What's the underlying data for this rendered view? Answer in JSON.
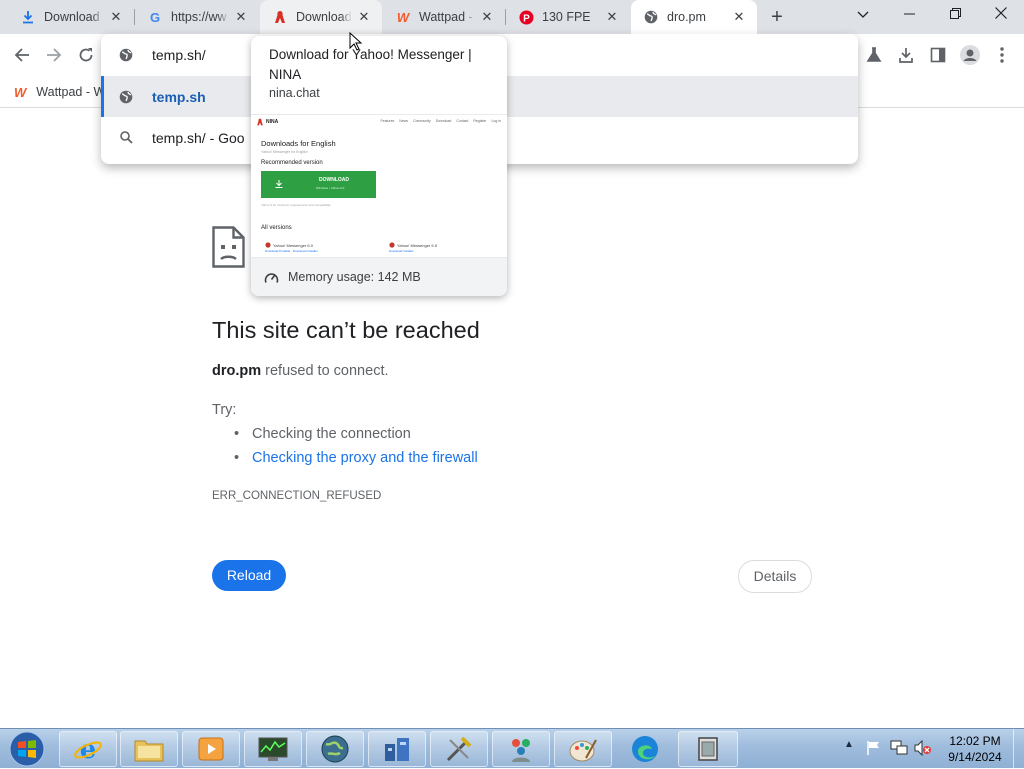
{
  "tabs": [
    {
      "title": "Download",
      "icon": "download-icon"
    },
    {
      "title": "https://ww",
      "icon": "google-icon"
    },
    {
      "title": "Download",
      "icon": "nina-icon"
    },
    {
      "title": "Wattpad -",
      "icon": "wattpad-icon"
    },
    {
      "title": "130 FPE",
      "icon": "pinterest-icon"
    },
    {
      "title": "dro.pm",
      "icon": "globe-icon"
    }
  ],
  "omnibox": {
    "input_value": "temp.sh/",
    "suggestions": [
      {
        "text": "temp.sh",
        "icon": "globe-icon"
      },
      {
        "text": "temp.sh/ - Goo",
        "icon": "search-icon"
      }
    ]
  },
  "bookmarks": [
    {
      "label": "Wattpad - W",
      "icon": "wattpad-icon"
    }
  ],
  "hover_card": {
    "title": "Download for Yahoo! Messenger | NINA",
    "domain": "nina.chat",
    "memory": "Memory usage: 142 MB",
    "thumbnail": {
      "brand": "NINA",
      "nav": [
        "Features",
        "News",
        "Community",
        "Download",
        "Contact",
        "Register",
        "Log in"
      ],
      "heading": "Downloads for English",
      "subheading": "Yahoo! Messenger for English",
      "recommended": "Recommended version",
      "download_label": "DOWNLOAD",
      "download_sub": "Windows • Yahoo 6.0",
      "note": "Yahoo 9 for minimum requirements and compatibility",
      "all_versions": "All versions",
      "versions": [
        "Yahoo! Messenger 6.0",
        "Yahoo! Messenger 5.5"
      ],
      "version_subs": [
        "Download Portable · Download Installer",
        "Download Installer"
      ]
    }
  },
  "error": {
    "heading": "This site can’t be reached",
    "domain": "dro.pm",
    "message": " refused to connect.",
    "try_label": "Try:",
    "suggestions": [
      "Checking the connection",
      "Checking the proxy and the firewall"
    ],
    "code": "ERR_CONNECTION_REFUSED",
    "reload_label": "Reload",
    "details_label": "Details"
  },
  "taskbar": {
    "apps": [
      "ie-icon",
      "explorer-icon",
      "media-player-icon",
      "task-manager-icon",
      "browser-globe-icon",
      "network-icon",
      "tools-icon",
      "users-icon",
      "paint-icon",
      "edge-icon",
      "window-icon"
    ],
    "time": "12:02 PM",
    "date": "9/14/2024"
  },
  "colors": {
    "accent": "#1a73e8",
    "tabstrip": "#dee1e6",
    "link": "#1a73e8"
  }
}
